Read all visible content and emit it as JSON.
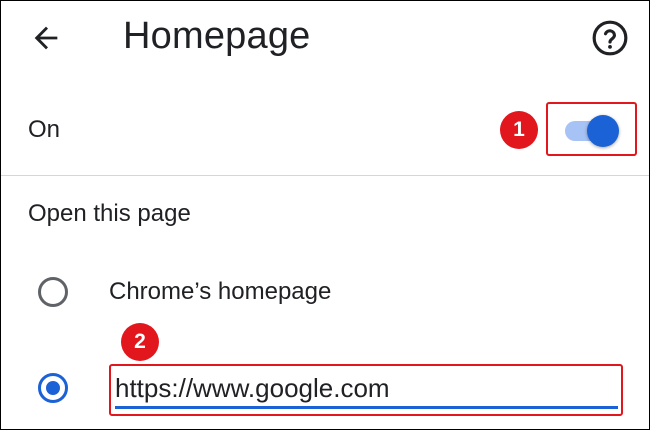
{
  "header": {
    "title": "Homepage",
    "back_icon": "arrow-back-icon",
    "help_icon": "help-circle-icon"
  },
  "toggle": {
    "label": "On",
    "state": "on"
  },
  "section": {
    "label": "Open this page"
  },
  "options": [
    {
      "label": "Chrome’s homepage",
      "selected": false
    },
    {
      "value": "https://www.google.com",
      "selected": true
    }
  ],
  "annotations": {
    "badge_1": "1",
    "badge_2": "2",
    "color": "#e2161d"
  },
  "colors": {
    "accent": "#1a62d6",
    "toggle_track": "#a7c2f4",
    "text": "#202124",
    "divider": "#d6d6d6"
  }
}
